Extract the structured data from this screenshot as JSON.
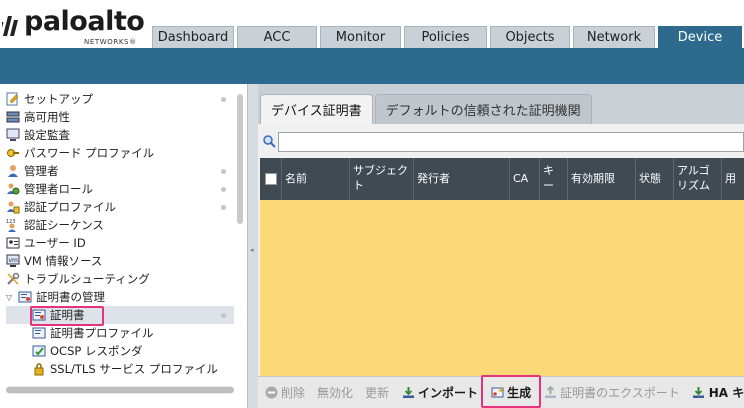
{
  "brand": {
    "name": "paloalto",
    "sub": "NETWORKS®"
  },
  "tabs": [
    {
      "label": "Dashboard",
      "active": false
    },
    {
      "label": "ACC",
      "active": false
    },
    {
      "label": "Monitor",
      "active": false
    },
    {
      "label": "Policies",
      "active": false
    },
    {
      "label": "Objects",
      "active": false
    },
    {
      "label": "Network",
      "active": false
    },
    {
      "label": "Device",
      "active": true
    }
  ],
  "sidebar": {
    "items": [
      {
        "label": "セットアップ",
        "icon": "setup-icon",
        "dot": true
      },
      {
        "label": "高可用性",
        "icon": "ha-icon",
        "dot": false
      },
      {
        "label": "設定監査",
        "icon": "config-audit-icon",
        "dot": false
      },
      {
        "label": "パスワード プロファイル",
        "icon": "password-profile-icon",
        "dot": false
      },
      {
        "label": "管理者",
        "icon": "administrator-icon",
        "dot": true
      },
      {
        "label": "管理者ロール",
        "icon": "admin-roles-icon",
        "dot": true
      },
      {
        "label": "認証プロファイル",
        "icon": "auth-profile-icon",
        "dot": true
      },
      {
        "label": "認証シーケンス",
        "icon": "auth-sequence-icon",
        "dot": false
      },
      {
        "label": "ユーザー ID",
        "icon": "user-id-icon",
        "dot": false
      },
      {
        "label": "VM 情報ソース",
        "icon": "vm-info-icon",
        "dot": false
      },
      {
        "label": "トラブルシューティング",
        "icon": "troubleshooting-icon",
        "dot": false
      },
      {
        "label": "証明書の管理",
        "icon": "cert-management-icon",
        "dot": false
      },
      {
        "label": "証明書",
        "icon": "certificate-icon",
        "dot": true
      },
      {
        "label": "証明書プロファイル",
        "icon": "cert-profile-icon",
        "dot": false
      },
      {
        "label": "OCSP レスポンダ",
        "icon": "ocsp-icon",
        "dot": false
      },
      {
        "label": "SSL/TLS サービス プロファイル",
        "icon": "ssl-tls-icon",
        "dot": false
      }
    ]
  },
  "content": {
    "tabs": [
      {
        "label": "デバイス証明書",
        "active": true
      },
      {
        "label": "デフォルトの信頼された証明機関",
        "active": false
      }
    ],
    "search": {
      "value": "",
      "placeholder": ""
    },
    "columns": [
      "名前",
      "サブジェクト",
      "発行者",
      "CA",
      "キー",
      "有効期限",
      "状態",
      "アルゴリズム",
      "用"
    ]
  },
  "toolbar": {
    "delete": "削除",
    "disable": "無効化",
    "renew": "更新",
    "import": "インポート",
    "generate": "生成",
    "export": "証明書のエクスポート",
    "ha_key": "HA キー"
  },
  "colors": {
    "accent": "#2e6a8e",
    "highlight": "#e6327d",
    "grid_body": "#fdd876",
    "grid_header": "#3f4a53"
  }
}
